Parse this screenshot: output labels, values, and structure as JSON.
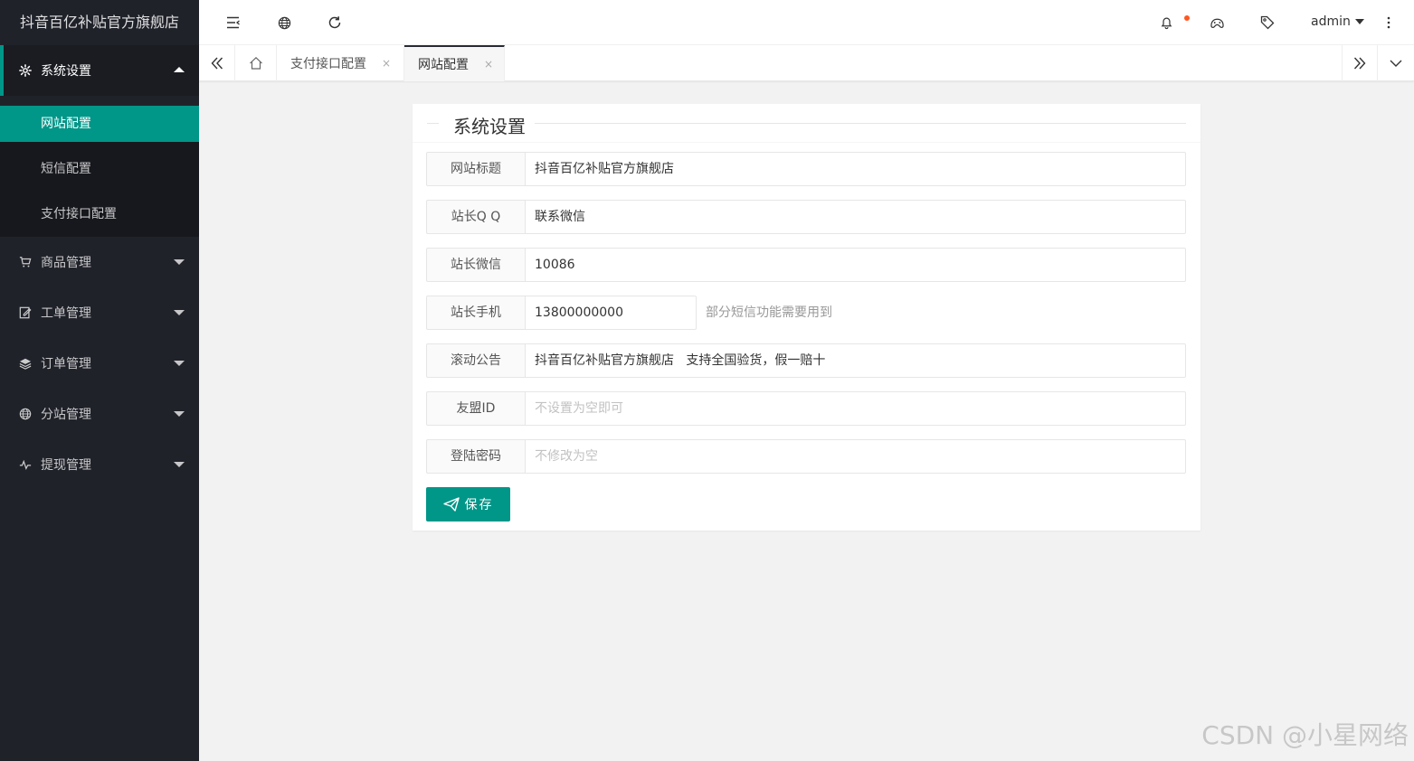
{
  "app": {
    "title": "抖音百亿补贴官方旗舰店"
  },
  "sidebar": {
    "groups": [
      {
        "label": "系统设置",
        "icon": "gear-icon",
        "open": true,
        "children": [
          {
            "label": "网站配置",
            "active": true
          },
          {
            "label": "短信配置",
            "active": false
          },
          {
            "label": "支付接口配置",
            "active": false
          }
        ]
      },
      {
        "label": "商品管理",
        "icon": "cart-icon",
        "open": false
      },
      {
        "label": "工单管理",
        "icon": "edit-icon",
        "open": false
      },
      {
        "label": "订单管理",
        "icon": "layers-icon",
        "open": false
      },
      {
        "label": "分站管理",
        "icon": "globe-icon",
        "open": false
      },
      {
        "label": "提现管理",
        "icon": "pulse-icon",
        "open": false
      }
    ]
  },
  "header": {
    "user": "admin",
    "icons": [
      "menu-fold-icon",
      "globe-icon",
      "refresh-icon",
      "bell-icon",
      "theme-icon",
      "tag-icon",
      "more-icon"
    ]
  },
  "tabs": [
    {
      "label": "支付接口配置",
      "close": "×",
      "active": false
    },
    {
      "label": "网站配置",
      "close": "×",
      "active": true
    }
  ],
  "form": {
    "title": "系统设置",
    "fields": [
      {
        "label": "网站标题",
        "value": "抖音百亿补贴官方旗舰店",
        "placeholder": ""
      },
      {
        "label": "站长Q Q",
        "value": "联系微信",
        "placeholder": ""
      },
      {
        "label": "站长微信",
        "value": "10086",
        "placeholder": ""
      },
      {
        "label": "站长手机",
        "value": "13800000000",
        "placeholder": "",
        "aux": "部分短信功能需要用到"
      },
      {
        "label": "滚动公告",
        "value": "抖音百亿补贴官方旗舰店   支持全国验货，假一赔十",
        "placeholder": ""
      },
      {
        "label": "友盟ID",
        "value": "",
        "placeholder": "不设置为空即可"
      },
      {
        "label": "登陆密码",
        "value": "",
        "placeholder": "不修改为空"
      }
    ],
    "save_label": "保存"
  },
  "watermark": "CSDN @小星网络",
  "colors": {
    "accent": "#009688",
    "sidebar": "#20222a",
    "notify": "#ff5722"
  }
}
